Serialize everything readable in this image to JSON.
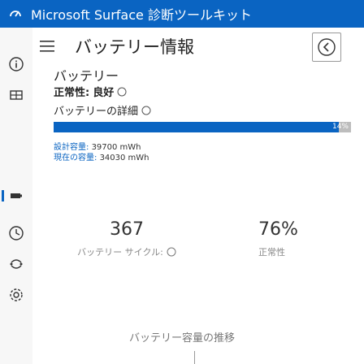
{
  "window": {
    "title": "Microsoft Surface 診断ツールキット"
  },
  "header": {
    "title": "バッテリー情報"
  },
  "battery": {
    "title": "バッテリー",
    "health_label": "正常性:",
    "health_value": "良好",
    "details_label": "バッテリーの詳細",
    "charge_text": "14%",
    "charge_fraction": 0.96,
    "design_capacity_label": "設計容量:",
    "design_capacity_value": "39700 mWh",
    "full_capacity_label": "現在の容量:",
    "full_capacity_value": "34030 mWh"
  },
  "cards": [
    {
      "value": "367",
      "label": "バッテリー サイクル:"
    },
    {
      "value": "76%",
      "label": "正常性"
    }
  ],
  "footer": {
    "title": "バッテリー容量の推移"
  },
  "colors": {
    "accent": "#0a64c2",
    "track": "#bdbdbd"
  },
  "icons": {
    "app": "surface-diagnostic-icon",
    "rail": [
      "info-icon",
      "device-icon",
      "battery-icon",
      "history-icon",
      "network-icon",
      "settings-icon"
    ]
  }
}
